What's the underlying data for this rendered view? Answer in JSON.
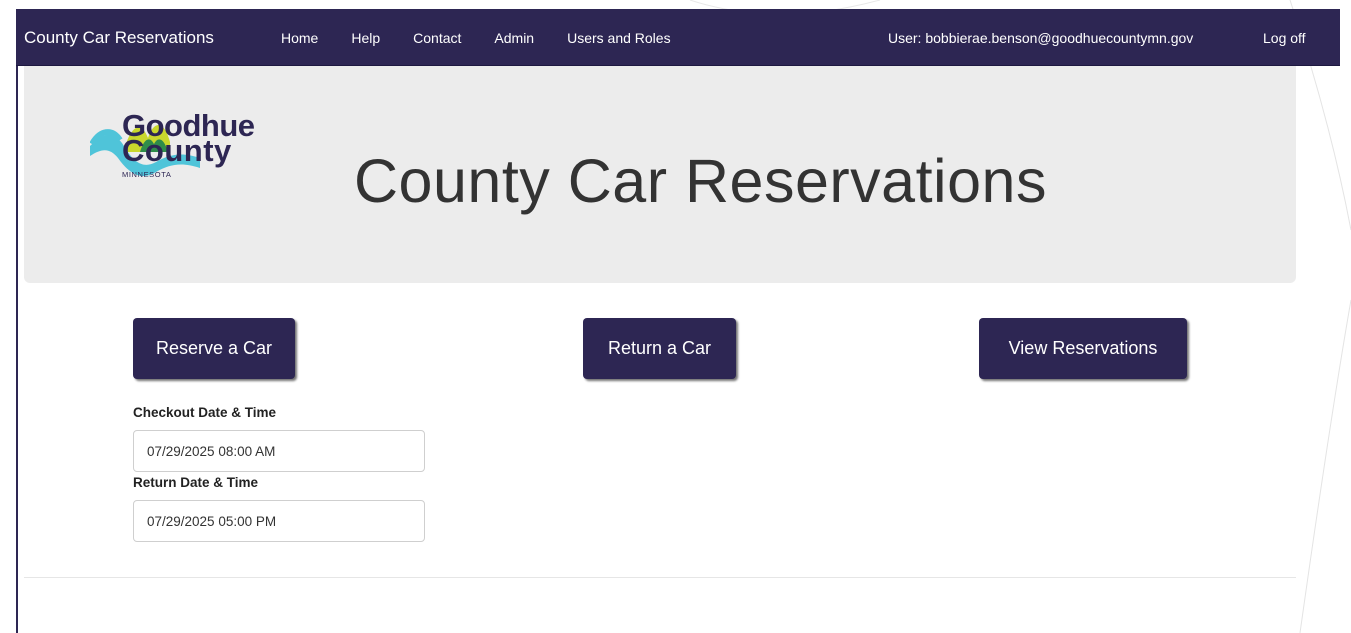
{
  "navbar": {
    "brand": "County Car Reservations",
    "links": [
      "Home",
      "Help",
      "Contact",
      "Admin",
      "Users and Roles"
    ],
    "user": "User: bobbierae.benson@goodhuecountymn.gov",
    "logoff": "Log off"
  },
  "logo": {
    "line1": "Goodhue",
    "line2": "County",
    "line3": "MINNESOTA"
  },
  "hero": {
    "title": "County Car Reservations"
  },
  "actions": {
    "reserve": "Reserve a Car",
    "return": "Return a Car",
    "view": "View Reservations"
  },
  "form": {
    "checkout_label": "Checkout Date & Time",
    "checkout_value": "07/29/2025 08:00 AM",
    "return_label": "Return Date & Time",
    "return_value": "07/29/2025 05:00 PM"
  },
  "colors": {
    "primary": "#2d2653",
    "jumbotron": "#ececec",
    "logo_teal": "#4fc4d9",
    "logo_lime": "#c9d72d",
    "logo_green": "#2f8c4a"
  }
}
